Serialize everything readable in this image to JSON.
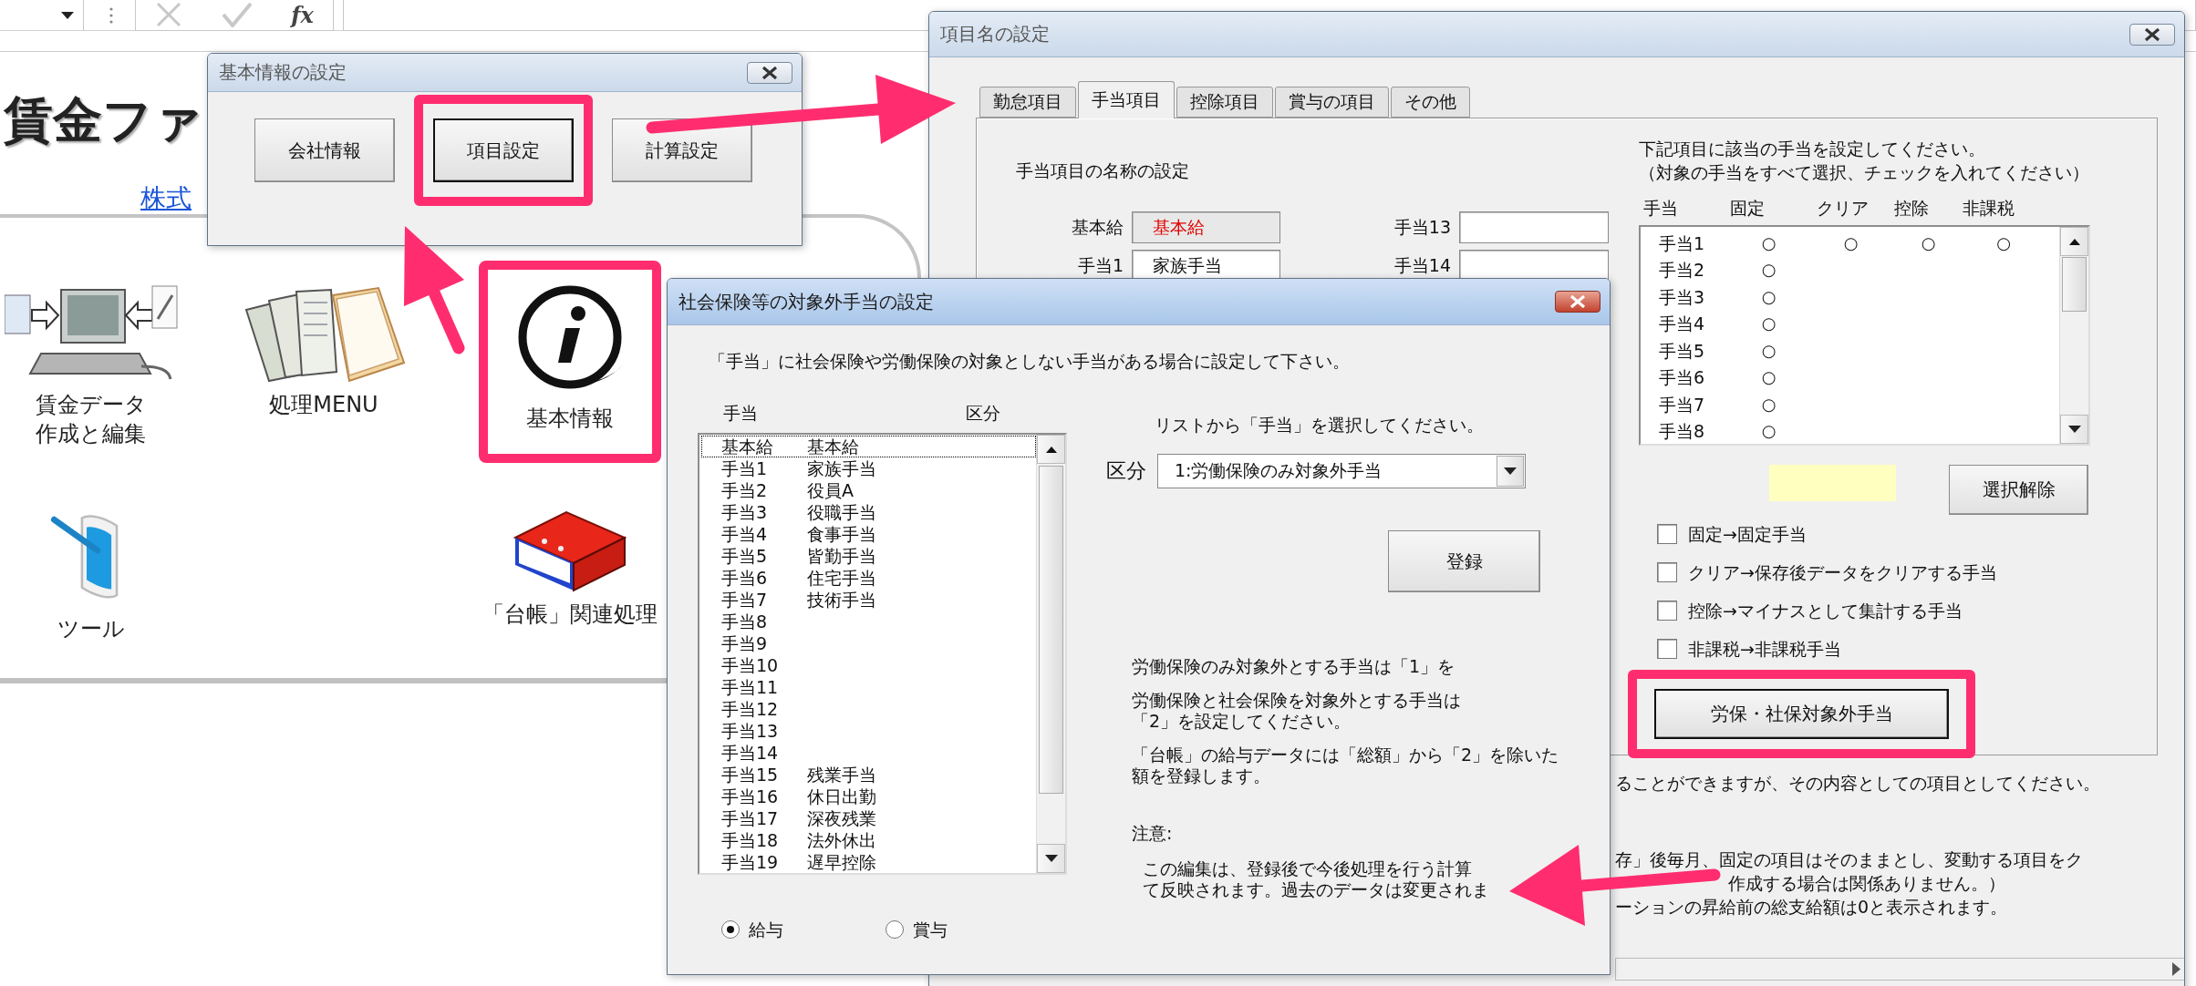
{
  "formula_bar": {
    "function_label": "fx"
  },
  "sheet": {
    "title": "賃金ファ",
    "company_link": "株式",
    "menu_rows": [
      [
        {
          "kind": "computer",
          "lines": [
            "賃金データ",
            "作成と編集"
          ],
          "highlighted": false
        },
        {
          "kind": "books",
          "lines": [
            "処理MENU"
          ],
          "highlighted": false
        },
        {
          "kind": "info",
          "lines": [
            "基本情報"
          ],
          "highlighted": true
        }
      ],
      [
        {
          "kind": "tablet",
          "lines": [
            "ツール"
          ],
          "highlighted": false
        },
        {
          "kind": "binder",
          "lines": [
            "「台帳」関連処理"
          ],
          "highlighted": false
        }
      ]
    ]
  },
  "basic_dialog": {
    "title": "基本情報の設定",
    "buttons": [
      {
        "label": "会社情報",
        "highlighted": false,
        "focused": false
      },
      {
        "label": "項目設定",
        "highlighted": true,
        "focused": true
      },
      {
        "label": "計算設定",
        "highlighted": false,
        "focused": false
      }
    ]
  },
  "item_dialog": {
    "title": "項目名の設定",
    "tabs": [
      {
        "label": "勤怠項目",
        "selected": false
      },
      {
        "label": "手当項目",
        "selected": true
      },
      {
        "label": "控除項目",
        "selected": false
      },
      {
        "label": "賞与の項目",
        "selected": false
      },
      {
        "label": "その他",
        "selected": false
      }
    ],
    "name_heading": "手当項目の名称の設定",
    "fields_left": [
      {
        "label": "基本給",
        "value": "基本給",
        "disabled": true
      },
      {
        "label": "手当1",
        "value": "家族手当",
        "disabled": false
      }
    ],
    "fields_right": [
      {
        "label": "手当13"
      },
      {
        "label": "手当14"
      }
    ],
    "instructions": [
      "下記項目に該当の手当を設定してください。",
      "（対象の手当をすべて選択、チェックを入れてください）"
    ],
    "columns": [
      "手当",
      "固定",
      "クリア",
      "控除",
      "非課税"
    ],
    "rows": [
      {
        "name": "手当1",
        "marks": [
          "○",
          "○",
          "○",
          "○"
        ]
      },
      {
        "name": "手当2",
        "marks": [
          "○"
        ]
      },
      {
        "name": "手当3",
        "marks": [
          "○"
        ]
      },
      {
        "name": "手当4",
        "marks": [
          "○"
        ]
      },
      {
        "name": "手当5",
        "marks": [
          "○"
        ]
      },
      {
        "name": "手当6",
        "marks": [
          "○"
        ]
      },
      {
        "name": "手当7",
        "marks": [
          "○"
        ]
      },
      {
        "name": "手当8",
        "marks": [
          "○"
        ]
      }
    ],
    "clear_button": "選択解除",
    "options": [
      {
        "label": "固定→固定手当",
        "checked": false
      },
      {
        "label": "クリア→保存後データをクリアする手当",
        "checked": false
      },
      {
        "label": "控除→マイナスとして集計する手当",
        "checked": false
      },
      {
        "label": "非課税→非課税手当",
        "checked": false
      }
    ],
    "exempt_button": {
      "label": "労保・社保対象外手当",
      "highlighted": true
    },
    "note": "ることができますが、その内容としての項目としてください。",
    "notes_lower": [
      "存」後毎月、固定の項目はそのままとし、変動する項目をク",
      "作成する場合は関係ありません。）",
      "ーションの昇給前の総支給額は0と表示されます。"
    ]
  },
  "exempt_dialog": {
    "title": "社会保険等の対象外手当の設定",
    "intro": "「手当」に社会保険や労働保険の対象としない手当がある場合に設定して下さい。",
    "list_headers": [
      "手当",
      "区分"
    ],
    "rows": [
      {
        "name": "基本給",
        "category": "基本給",
        "selected": true
      },
      {
        "name": "手当1",
        "category": "家族手当",
        "selected": false
      },
      {
        "name": "手当2",
        "category": "役員A",
        "selected": false
      },
      {
        "name": "手当3",
        "category": "役職手当",
        "selected": false
      },
      {
        "name": "手当4",
        "category": "食事手当",
        "selected": false
      },
      {
        "name": "手当5",
        "category": "皆勤手当",
        "selected": false
      },
      {
        "name": "手当6",
        "category": "住宅手当",
        "selected": false
      },
      {
        "name": "手当7",
        "category": "技術手当",
        "selected": false
      },
      {
        "name": "手当8",
        "selected": false
      },
      {
        "name": "手当9",
        "selected": false
      },
      {
        "name": "手当10",
        "selected": false
      },
      {
        "name": "手当11",
        "selected": false
      },
      {
        "name": "手当12",
        "selected": false
      },
      {
        "name": "手当13",
        "selected": false
      },
      {
        "name": "手当14",
        "selected": false
      },
      {
        "name": "手当15",
        "category": "残業手当",
        "selected": false
      },
      {
        "name": "手当16",
        "category": "休日出勤",
        "selected": false
      },
      {
        "name": "手当17",
        "category": "深夜残業",
        "selected": false
      },
      {
        "name": "手当18",
        "category": "法外休出",
        "selected": false
      },
      {
        "name": "手当19",
        "category": "遅早控除",
        "selected": false
      }
    ],
    "select_prompt": "リストから「手当」を選択してください。",
    "category_label": "区分",
    "category_value": "1:労働保険のみ対象外手当",
    "register_button": "登録",
    "help": [
      "労働保険のみ対象外とする手当は「1」を",
      "労働保険と社会保険を対象外とする手当は「2」を設定してください。",
      "「台帳」の給与データには「総額」から「2」を除いた額を登録します。"
    ],
    "caution_label": "注意:",
    "caution_lines": [
      "この編集は、登録後で今後処理を行う計算",
      "て反映されます。過去のデータは変更されま"
    ],
    "pay_types": [
      {
        "label": "給与",
        "selected": true
      },
      {
        "label": "賞与",
        "selected": false
      }
    ]
  }
}
